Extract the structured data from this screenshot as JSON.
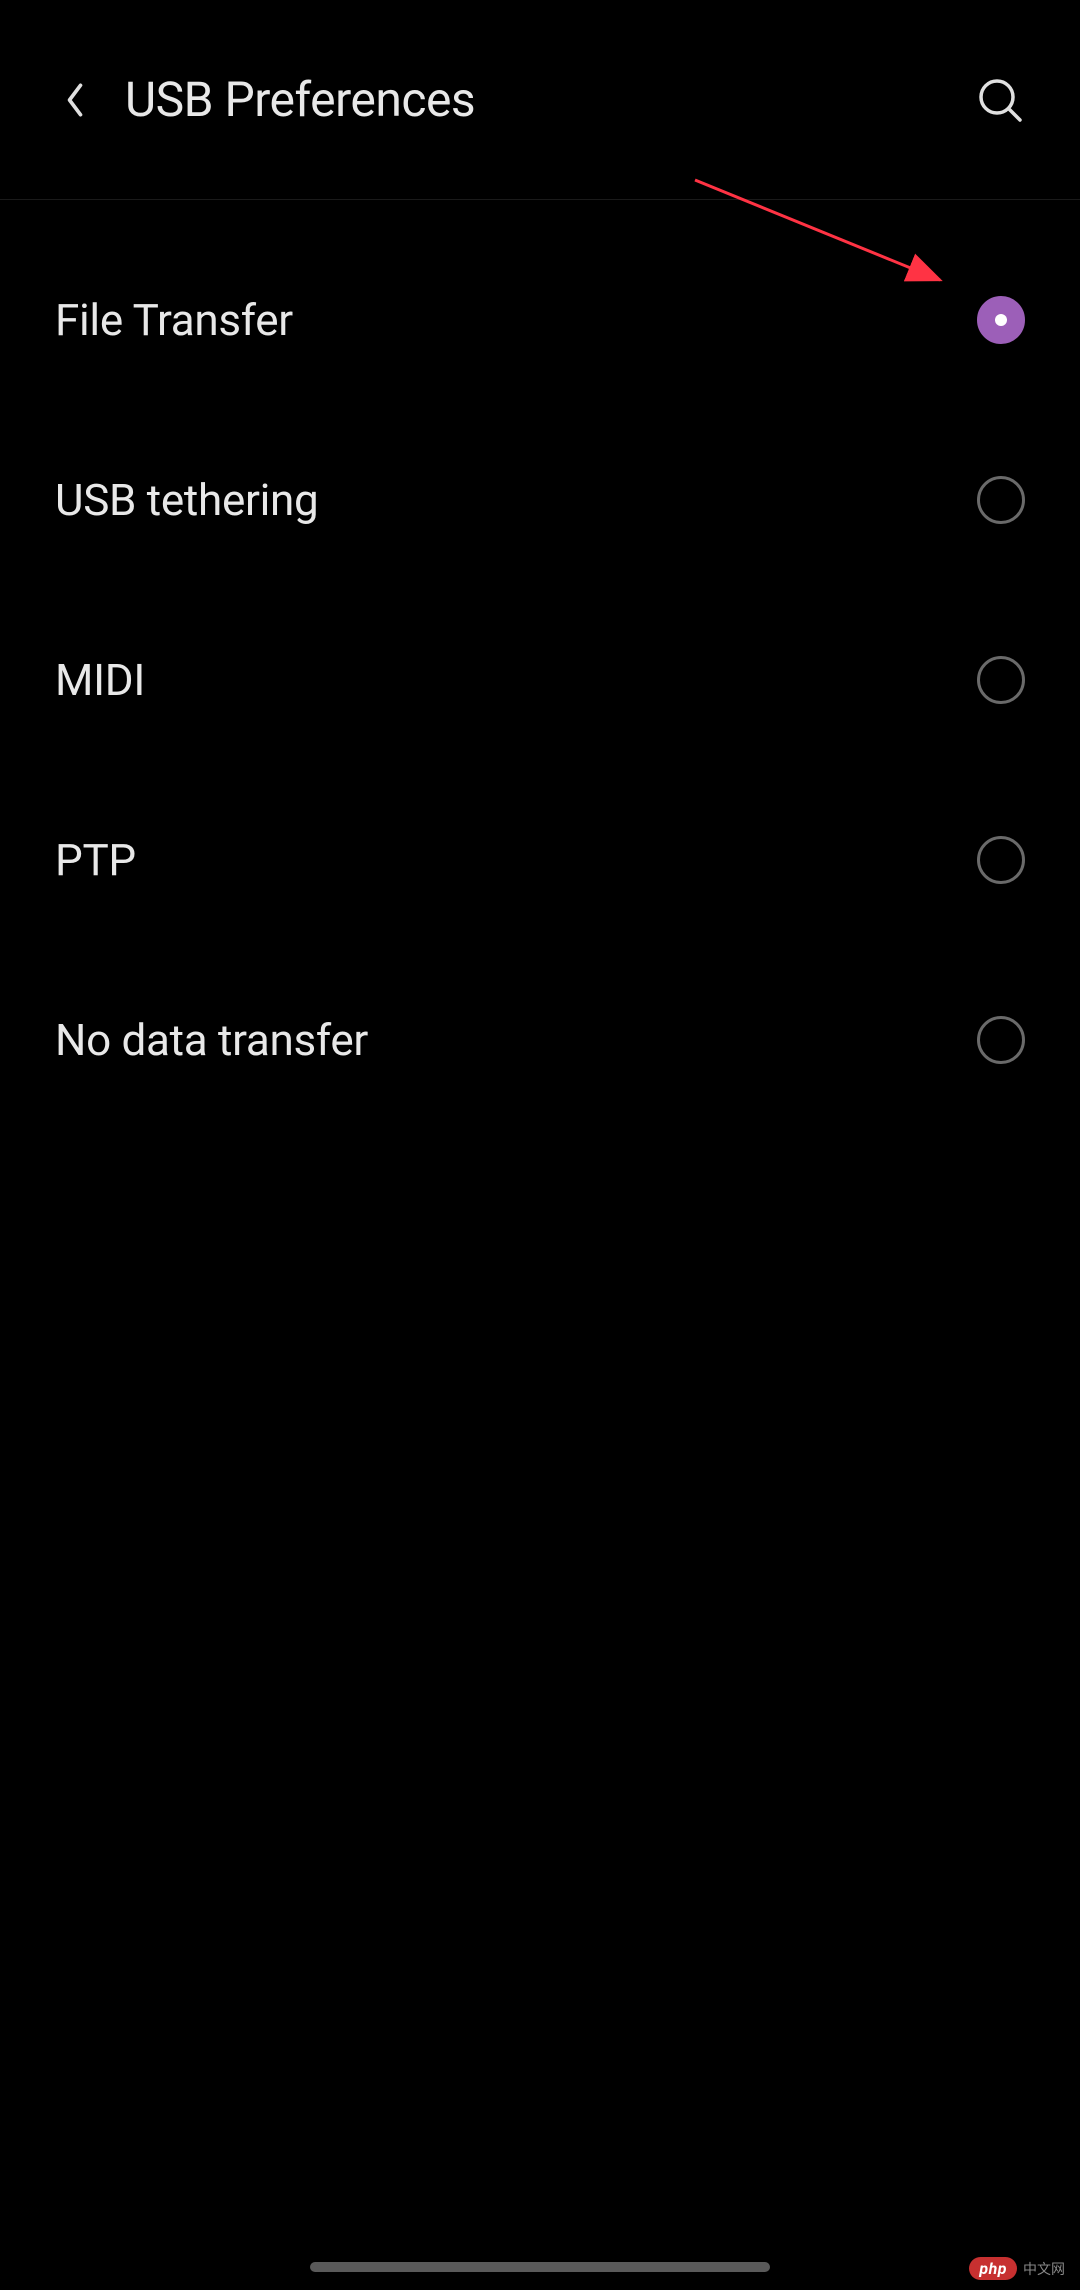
{
  "header": {
    "title": "USB Preferences"
  },
  "options": [
    {
      "label": "File Transfer",
      "selected": true
    },
    {
      "label": "USB tethering",
      "selected": false
    },
    {
      "label": "MIDI",
      "selected": false
    },
    {
      "label": "PTP",
      "selected": false
    },
    {
      "label": "No data transfer",
      "selected": false
    }
  ],
  "watermark": {
    "badge": "php",
    "text": "中文网"
  }
}
